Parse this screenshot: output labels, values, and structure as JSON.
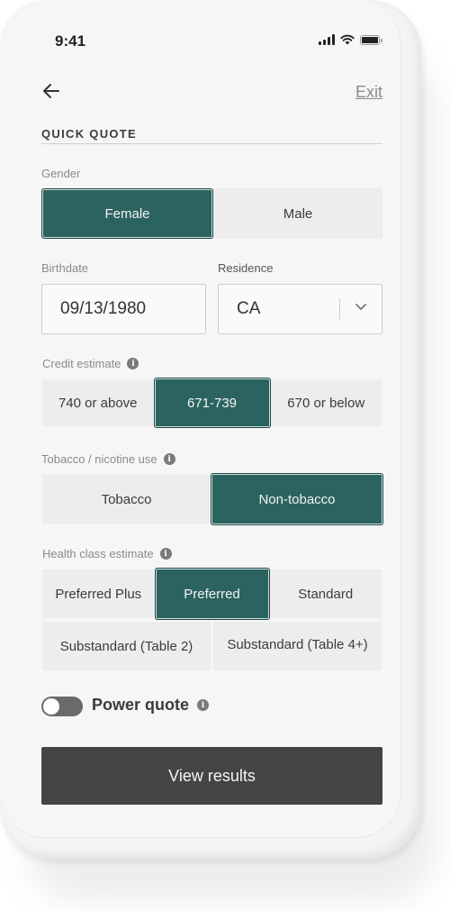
{
  "status_bar": {
    "time": "9:41",
    "icons": [
      "cellular-signal-icon",
      "wifi-icon",
      "battery-icon"
    ]
  },
  "nav": {
    "back_icon": "arrow-left-icon",
    "exit_label": "Exit"
  },
  "form": {
    "title": "QUICK QUOTE",
    "gender": {
      "label": "Gender",
      "options": [
        "Female",
        "Male"
      ],
      "selected": "Female"
    },
    "birthdate": {
      "label": "Birthdate",
      "value": "09/13/1980"
    },
    "residence": {
      "label": "Residence",
      "value": "CA"
    },
    "credit": {
      "label": "Credit estimate",
      "options": [
        "740 or above",
        "671-739",
        "670 or below"
      ],
      "selected": "671-739"
    },
    "tobacco": {
      "label": "Tobacco / nicotine use",
      "options": [
        "Tobacco",
        "Non-tobacco"
      ],
      "selected": "Non-tobacco"
    },
    "health": {
      "label": "Health class estimate",
      "options": [
        "Preferred Plus",
        "Preferred",
        "Standard",
        "Substandard (Table 2)",
        "Substandard (Table 4+)"
      ],
      "selected": "Preferred"
    },
    "power_quote": {
      "label": "Power quote",
      "enabled": false
    },
    "submit_label": "View results"
  },
  "colors": {
    "accent": "#2b6360",
    "button_dark": "#444444",
    "segment_bg": "#ededed"
  }
}
